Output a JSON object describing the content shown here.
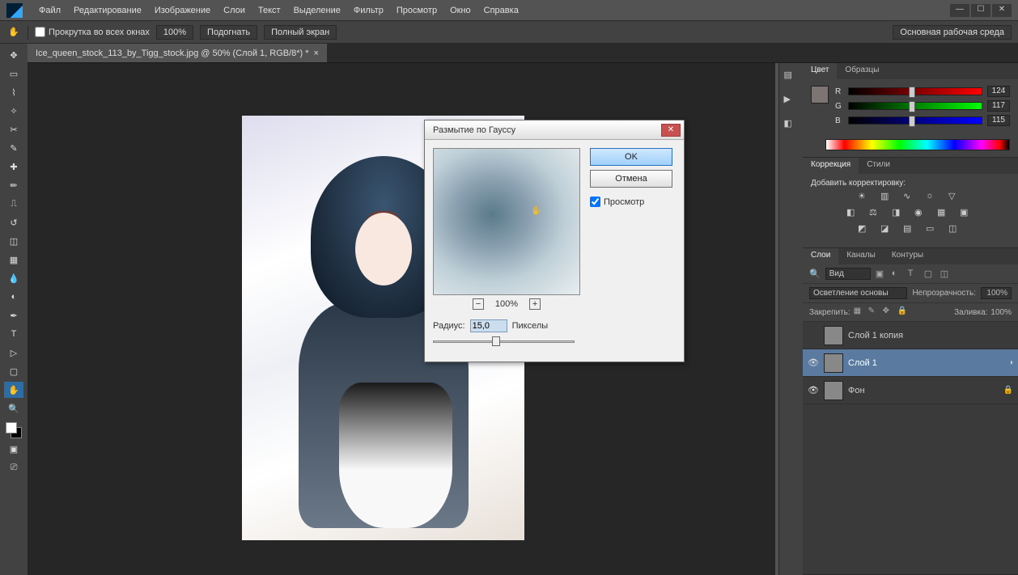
{
  "menubar": [
    "Файл",
    "Редактирование",
    "Изображение",
    "Слои",
    "Текст",
    "Выделение",
    "Фильтр",
    "Просмотр",
    "Окно",
    "Справка"
  ],
  "options": {
    "scroll_all": "Прокрутка во всех окнах",
    "zoom": "100%",
    "fit": "Подогнать",
    "fullscreen": "Полный экран",
    "workspace": "Основная рабочая среда"
  },
  "tab": {
    "title": "Ice_queen_stock_113_by_Tigg_stock.jpg @ 50% (Слой 1, RGB/8*) *"
  },
  "dialog": {
    "title": "Размытие по Гауссу",
    "ok": "OK",
    "cancel": "Отмена",
    "preview": "Просмотр",
    "zoom": "100%",
    "minus": "−",
    "plus": "+",
    "radius_label": "Радиус:",
    "radius_value": "15,0",
    "radius_unit": "Пикселы"
  },
  "color_panel": {
    "tabs": [
      "Цвет",
      "Образцы"
    ],
    "r_lab": "R",
    "g_lab": "G",
    "b_lab": "B",
    "r": "124",
    "g": "117",
    "b": "115"
  },
  "adjust_panel": {
    "tabs": [
      "Коррекция",
      "Стили"
    ],
    "hint": "Добавить корректировку:"
  },
  "layers_panel": {
    "tabs": [
      "Слои",
      "Каналы",
      "Контуры"
    ],
    "kind": "Вид",
    "blend": "Осветление основы",
    "opacity_lbl": "Непрозрачность:",
    "opacity": "100%",
    "lock_lbl": "Закрепить:",
    "fill_lbl": "Заливка:",
    "fill": "100%",
    "layers": [
      {
        "name": "Слой 1 копия",
        "visible": false,
        "selected": false,
        "locked": false
      },
      {
        "name": "Слой 1",
        "visible": true,
        "selected": true,
        "locked": false
      },
      {
        "name": "Фон",
        "visible": true,
        "selected": false,
        "locked": true
      }
    ]
  }
}
